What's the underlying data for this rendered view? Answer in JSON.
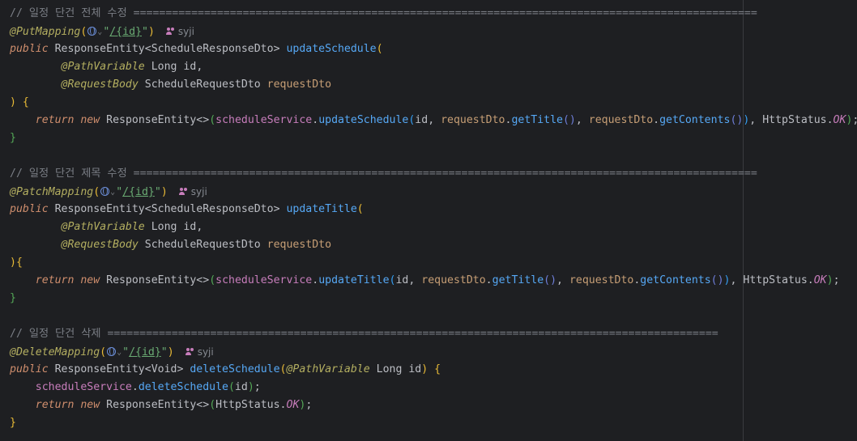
{
  "editor": {
    "separator_put": "=================================================================================================",
    "separator_patch": "=================================================================================================",
    "separator_delete": "===============================================================================================",
    "comment_put": "// 일정 단건 전체 수정 ",
    "comment_patch": "// 일정 단건 제목 수정 ",
    "comment_delete": "// 일정 단건 삭제 ",
    "author": "syji",
    "path": "/{id}",
    "put": {
      "annotation": "@PutMapping",
      "method": "updateSchedule",
      "service_call": "updateSchedule"
    },
    "patch": {
      "annotation": "@PatchMapping",
      "method": "updateTitle",
      "service_call": "updateTitle"
    },
    "delete": {
      "annotation": "@DeleteMapping",
      "method": "deleteSchedule",
      "service_call": "deleteSchedule"
    },
    "tokens": {
      "public": "public",
      "return": "return",
      "new": "new",
      "response_type": "ResponseEntity",
      "dto_response": "ScheduleResponseDto",
      "dto_request": "ScheduleRequestDto",
      "void_type": "Void",
      "path_variable": "@PathVariable",
      "request_body": "@RequestBody",
      "long_type": "Long",
      "id": "id",
      "request_dto": "requestDto",
      "service": "scheduleService",
      "get_title": "getTitle",
      "get_contents": "getContents",
      "http_status": "HttpStatus",
      "ok": "OK"
    }
  }
}
